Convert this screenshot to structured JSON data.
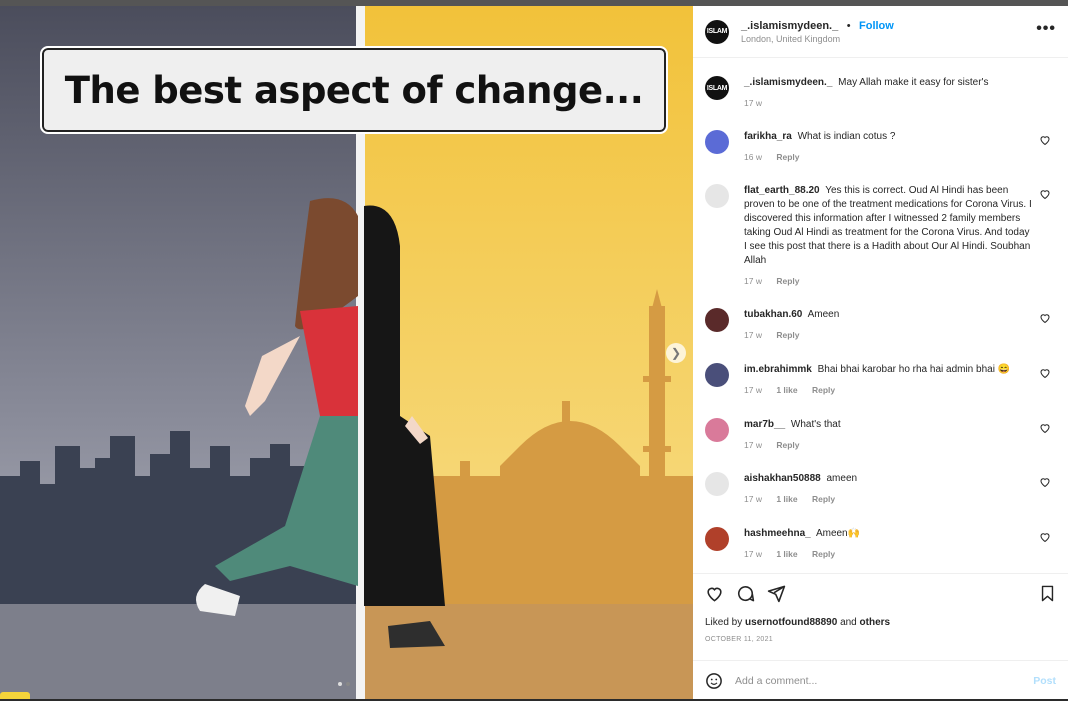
{
  "post": {
    "username": "_.islamismydeen._",
    "follow_label": "Follow",
    "location": "London, United Kingdom",
    "avatar_text": "ISLAM",
    "more_label": "•••"
  },
  "media": {
    "title": "The best aspect of change...",
    "next_icon": "chevron-right-icon",
    "page_count": 2
  },
  "caption": {
    "username": "_.islamismydeen._",
    "text": "May Allah make it easy for sister's",
    "time": "17 w"
  },
  "comments": [
    {
      "username": "farikha_ra",
      "text": "What is indian cotus ?",
      "time": "16 w",
      "likes": "",
      "reply": "Reply",
      "avatar_color": "#5b6bd6"
    },
    {
      "username": "flat_earth_88.20",
      "text": "Yes this is correct. Oud Al Hindi has been proven to be one of the treatment medications for Corona Virus. I discovered this information after I witnessed 2 family members taking Oud Al Hindi as treatment for the Corona Virus. And today I see this post that there is a Hadith about Our Al Hindi. Soubhan Allah",
      "time": "17 w",
      "likes": "",
      "reply": "Reply",
      "avatar_color": "#e6e6e6"
    },
    {
      "username": "tubakhan.60",
      "text": "Ameen",
      "time": "17 w",
      "likes": "",
      "reply": "Reply",
      "avatar_color": "#5a2a2a"
    },
    {
      "username": "im.ebrahimmk",
      "text": "Bhai bhai karobar ho rha hai admin bhai 😄",
      "time": "17 w",
      "likes": "1 like",
      "reply": "Reply",
      "avatar_color": "#4a4f7a"
    },
    {
      "username": "mar7b__",
      "text": "What's that",
      "time": "17 w",
      "likes": "",
      "reply": "Reply",
      "avatar_color": "#d97a9a"
    },
    {
      "username": "aishakhan50888",
      "text": "ameen",
      "time": "17 w",
      "likes": "1 like",
      "reply": "Reply",
      "avatar_color": "#e6e6e6"
    },
    {
      "username": "hashmeehna_",
      "text": "Ameen🙌",
      "time": "17 w",
      "likes": "1 like",
      "reply": "Reply",
      "avatar_color": "#b0402a"
    }
  ],
  "actions": {
    "liked_prefix": "Liked by",
    "liked_user": "usernotfound88890",
    "liked_and": "and",
    "liked_others": "others",
    "date": "OCTOBER 11, 2021",
    "add_comment_placeholder": "Add a comment...",
    "post_label": "Post"
  },
  "colors": {
    "accent": "#0095f6",
    "muted": "#8e8e8e",
    "left_bg": "#5a5d6e",
    "right_bg": "#f4c842"
  }
}
